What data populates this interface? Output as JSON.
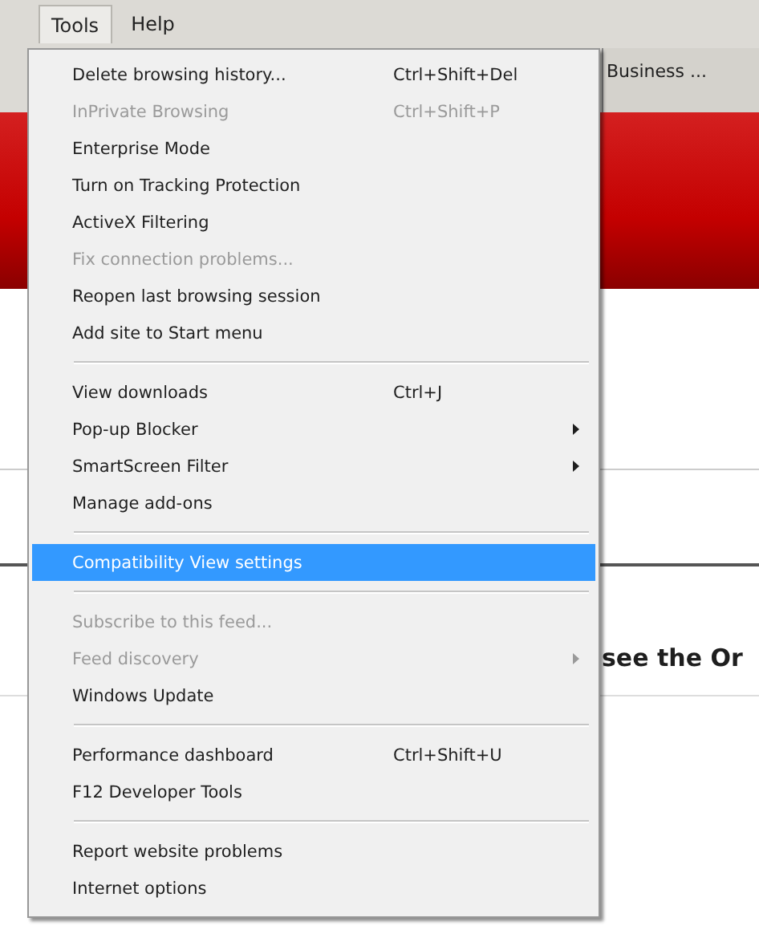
{
  "menubar": [
    {
      "label": "Tools",
      "selected": true
    },
    {
      "label": "Help",
      "selected": false
    }
  ],
  "page": {
    "tab": "Business ...",
    "heading": "see the Or"
  },
  "menu": {
    "items": [
      {
        "kind": "item",
        "label": "Delete browsing history...",
        "shortcut": "Ctrl+Shift+Del",
        "disabled": false,
        "selected": false
      },
      {
        "kind": "item",
        "label": "InPrivate Browsing",
        "shortcut": "Ctrl+Shift+P",
        "disabled": true,
        "selected": false
      },
      {
        "kind": "item",
        "label": "Enterprise Mode",
        "disabled": false,
        "selected": false
      },
      {
        "kind": "item",
        "label": "Turn on Tracking Protection",
        "disabled": false,
        "selected": false
      },
      {
        "kind": "item",
        "label": "ActiveX Filtering",
        "disabled": false,
        "selected": false
      },
      {
        "kind": "item",
        "label": "Fix connection problems...",
        "disabled": true,
        "selected": false
      },
      {
        "kind": "item",
        "label": "Reopen last browsing session",
        "disabled": false,
        "selected": false
      },
      {
        "kind": "item",
        "label": "Add site to Start menu",
        "disabled": false,
        "selected": false
      },
      {
        "kind": "separator"
      },
      {
        "kind": "item",
        "label": "View downloads",
        "shortcut": "Ctrl+J",
        "disabled": false,
        "selected": false
      },
      {
        "kind": "item",
        "label": "Pop-up Blocker",
        "submenu": true,
        "disabled": false,
        "selected": false
      },
      {
        "kind": "item",
        "label": "SmartScreen Filter",
        "submenu": true,
        "disabled": false,
        "selected": false
      },
      {
        "kind": "item",
        "label": "Manage add-ons",
        "disabled": false,
        "selected": false
      },
      {
        "kind": "separator"
      },
      {
        "kind": "item",
        "label": "Compatibility View settings",
        "disabled": false,
        "selected": true
      },
      {
        "kind": "separator"
      },
      {
        "kind": "item",
        "label": "Subscribe to this feed...",
        "disabled": true,
        "selected": false
      },
      {
        "kind": "item",
        "label": "Feed discovery",
        "submenu": true,
        "disabled": true,
        "selected": false
      },
      {
        "kind": "item",
        "label": "Windows Update",
        "disabled": false,
        "selected": false
      },
      {
        "kind": "separator"
      },
      {
        "kind": "item",
        "label": "Performance dashboard",
        "shortcut": "Ctrl+Shift+U",
        "disabled": false,
        "selected": false
      },
      {
        "kind": "item",
        "label": "F12 Developer Tools",
        "disabled": false,
        "selected": false
      },
      {
        "kind": "separator"
      },
      {
        "kind": "item",
        "label": "Report website problems",
        "disabled": false,
        "selected": false
      },
      {
        "kind": "item",
        "label": "Internet options",
        "disabled": false,
        "selected": false
      }
    ]
  }
}
